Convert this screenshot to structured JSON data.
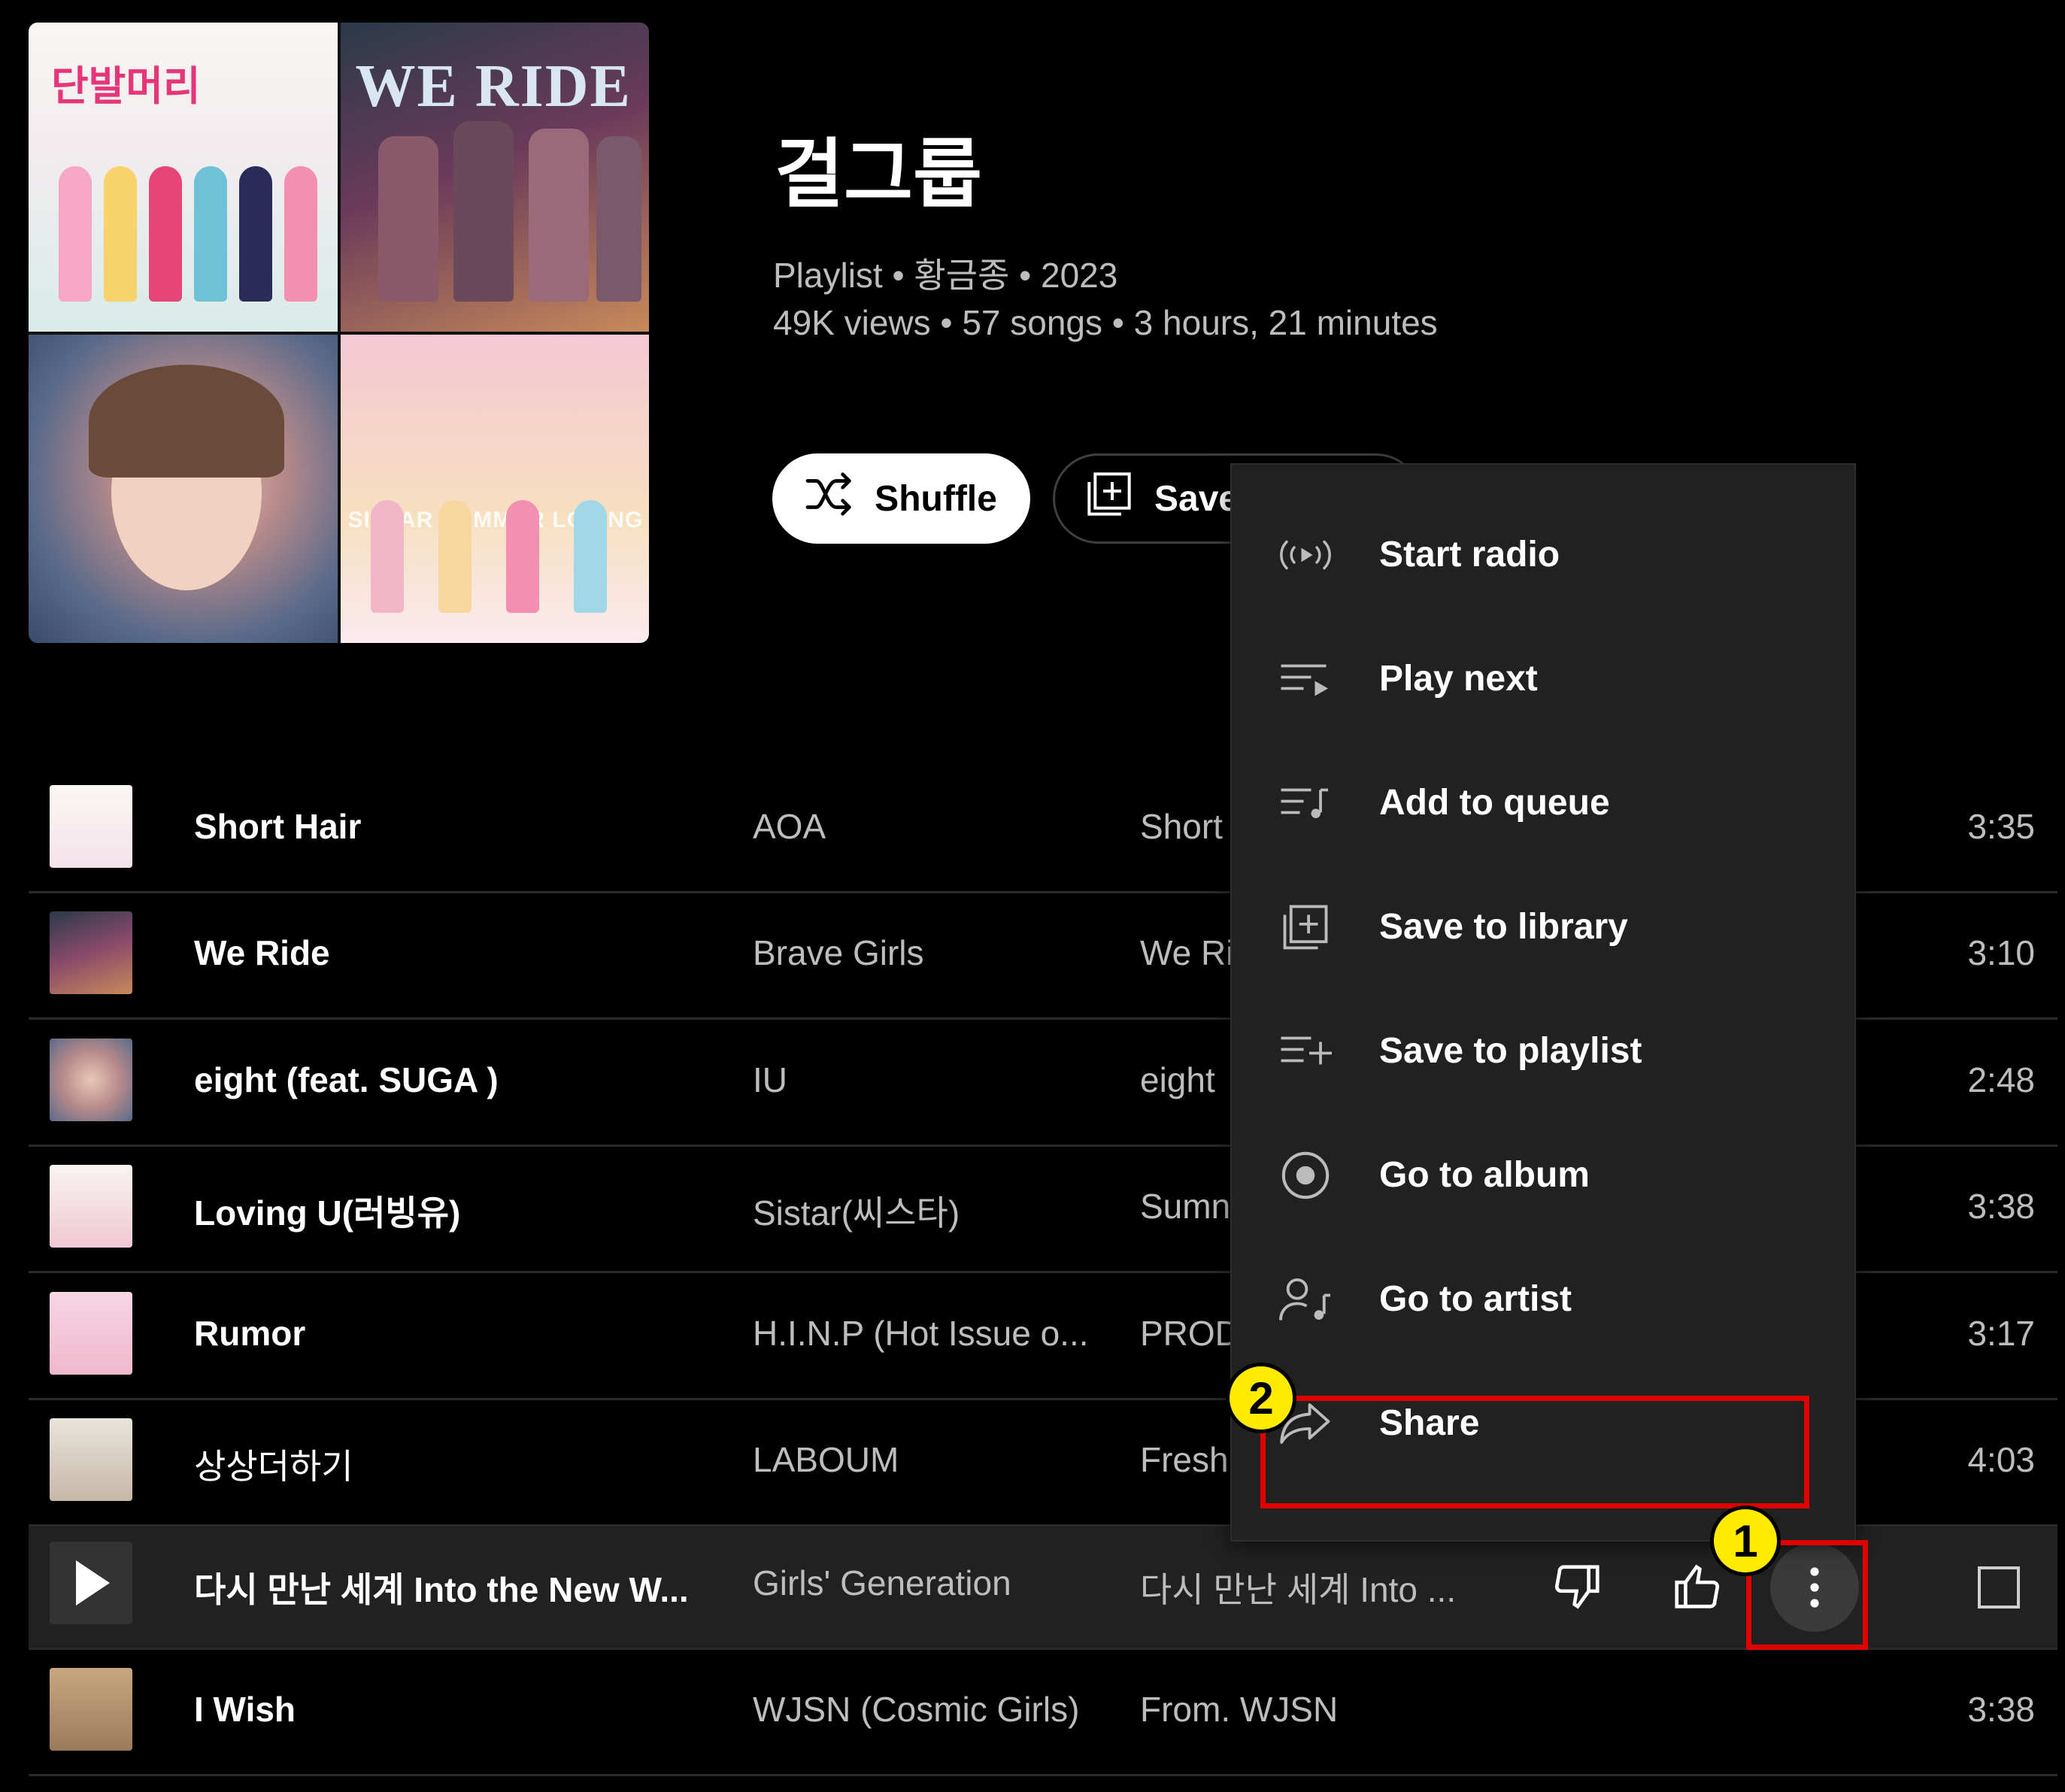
{
  "playlist": {
    "title": "걸그룹",
    "meta_line1": "Playlist • 황금종 • 2023",
    "meta_line2": "49K views • 57 songs • 3 hours, 21 minutes",
    "shuffle_label": "Shuffle",
    "save_label": "Save"
  },
  "cover_art": {
    "tile1_text": "단발머리",
    "tile2_text": "WE RIDE",
    "tile4_text": "SISTAR SUMMER LOVING"
  },
  "tracks": [
    {
      "title": "Short Hair",
      "artist": "AOA",
      "album": "Short",
      "duration": "3:35"
    },
    {
      "title": "We Ride",
      "artist": "Brave Girls",
      "album": "We Ri",
      "duration": "3:10"
    },
    {
      "title": "eight (feat. SUGA )",
      "artist": "IU",
      "album": "eight",
      "duration": "2:48"
    },
    {
      "title": "Loving U(러빙유)",
      "artist": "Sistar(씨스타)",
      "album": "Sumn",
      "duration": "3:38"
    },
    {
      "title": "Rumor",
      "artist": "H.I.N.P (Hot Issue o...",
      "album": "PROD",
      "duration": "3:17"
    },
    {
      "title": "상상더하기",
      "artist": "LABOUM",
      "album": "Fresh",
      "duration": "4:03"
    },
    {
      "title": "다시 만난 세계 Into the New W...",
      "artist": "Girls' Generation",
      "album": "다시 만난 세계 Into ...",
      "duration": ""
    },
    {
      "title": "I Wish",
      "artist": "WJSN (Cosmic Girls)",
      "album": "From. WJSN",
      "duration": "3:38"
    }
  ],
  "context_menu": {
    "items": [
      {
        "label": "Start radio",
        "icon": "radio-icon"
      },
      {
        "label": "Play next",
        "icon": "play-next-icon"
      },
      {
        "label": "Add to queue",
        "icon": "queue-icon"
      },
      {
        "label": "Save to library",
        "icon": "library-add-icon"
      },
      {
        "label": "Save to playlist",
        "icon": "playlist-add-icon"
      },
      {
        "label": "Go to album",
        "icon": "album-icon"
      },
      {
        "label": "Go to artist",
        "icon": "artist-icon"
      },
      {
        "label": "Share",
        "icon": "share-icon"
      }
    ]
  },
  "annotations": {
    "badge1": "1",
    "badge2": "2",
    "highlight_color": "#e00000",
    "badge_color": "#ffea00"
  }
}
